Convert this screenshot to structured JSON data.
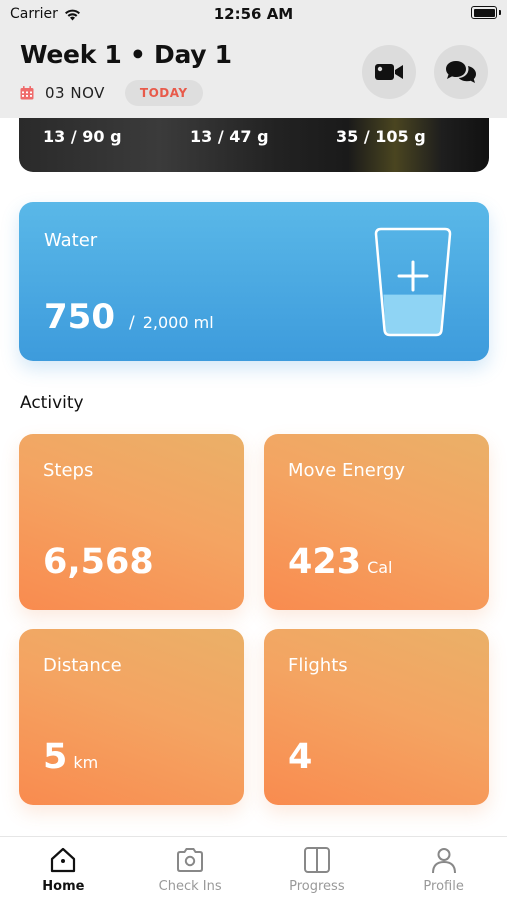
{
  "status_bar": {
    "carrier": "Carrier",
    "time": "12:56 AM"
  },
  "header": {
    "title": "Week 1 • Day 1",
    "date": "03 NOV",
    "today_label": "TODAY",
    "icons": [
      "calendar-icon",
      "video-camera-icon",
      "chat-bubbles-icon"
    ]
  },
  "nutrition": {
    "values": [
      "13 / 90 g",
      "13 / 47 g",
      "35 / 105 g"
    ]
  },
  "water": {
    "label": "Water",
    "value": "750",
    "separator": "/",
    "goal": "2,000 ml",
    "fill_fraction": 0.375,
    "icon": "water-glass-add-icon",
    "color": "#4aa8e2"
  },
  "activity": {
    "title": "Activity",
    "cards": [
      {
        "label": "Steps",
        "value": "6,568",
        "unit": ""
      },
      {
        "label": "Move Energy",
        "value": "423",
        "unit": "Cal"
      },
      {
        "label": "Distance",
        "value": "5",
        "unit": "km"
      },
      {
        "label": "Flights",
        "value": "4",
        "unit": ""
      }
    ],
    "color": "#f59a5a"
  },
  "tabbar": {
    "items": [
      {
        "label": "Home",
        "icon": "home-icon",
        "active": true
      },
      {
        "label": "Check Ins",
        "icon": "camera-icon",
        "active": false
      },
      {
        "label": "Progress",
        "icon": "progress-icon",
        "active": false
      },
      {
        "label": "Profile",
        "icon": "person-icon",
        "active": false
      }
    ]
  }
}
